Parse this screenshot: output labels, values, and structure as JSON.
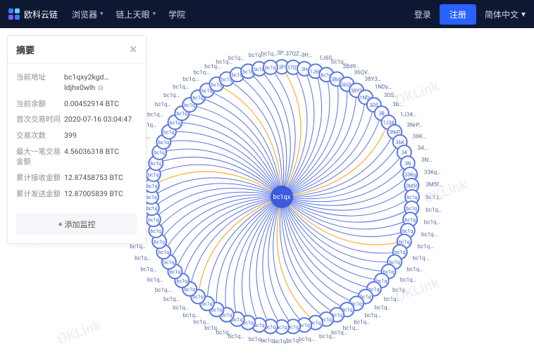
{
  "header": {
    "brand": "欧科云链",
    "nav": {
      "browser": "浏览器",
      "chain_tools": "链上天眼",
      "academy": "学院"
    },
    "login": "登录",
    "register": "注册",
    "lang": "简体中文"
  },
  "panel": {
    "title": "摘要",
    "rows": {
      "address_k": "当前地址",
      "address_v": "bc1qxy2kgd…ldjhx0wlh",
      "balance_k": "当前余额",
      "balance_v": "0.00452914 BTC",
      "first_tx_k": "首次交易时间",
      "first_tx_v": "2020-07-16 03:04:47",
      "tx_count_k": "交易次数",
      "tx_count_v": "399",
      "max_single_k": "最大一笔交易金额",
      "max_single_v": "4.56036318 BTC",
      "total_recv_k": "累计接收金额",
      "total_recv_v": "12.87458753 BTC",
      "total_sent_k": "累计发送金额",
      "total_sent_v": "12.87005839 BTC"
    },
    "add_monitor": "+ 添加监控"
  },
  "graph": {
    "center_label": "bc1qx",
    "watermark": "OKLink",
    "node_default_label": "bc1q",
    "node_labels": [
      "3P",
      "37QZ",
      "3H",
      "1J6S",
      "bc1q",
      "3Bd9",
      "36QV",
      "38Y3",
      "1NDy",
      "3DS",
      "3B",
      "1J34",
      "3NrP",
      "36K",
      "34",
      "3N",
      "33Kq",
      "3M5f",
      "bc1q",
      "bc1q",
      "bc1q",
      "bc1q",
      "bc1q",
      "bc1q",
      "bc1q",
      "bc1q",
      "bc1q",
      "bc1q",
      "bc1q",
      "bc1q",
      "bc1q",
      "bc1q",
      "bc1q",
      "bc1q",
      "bc1q",
      "bc1q",
      "bc1q",
      "bc1q",
      "bc1q",
      "bc1q",
      "bc1q",
      "bc1q",
      "bc1q",
      "bc1q",
      "bc1q",
      "bc1q",
      "bc1q",
      "bc1q",
      "bc1q",
      "bc1q",
      "bc1q",
      "bc1q",
      "bc1q",
      "bc1q",
      "bc1q",
      "bc1q",
      "bc1q",
      "bc1q",
      "bc1q",
      "bc1q",
      "bc1q",
      "bc1q",
      "bc1q",
      "bc1q",
      "bc1q",
      "bc1q",
      "bc1q",
      "bc1q",
      "bc1q",
      "bc1q",
      "bc1q",
      "bc1q"
    ]
  },
  "chart_data": {
    "type": "network",
    "center": "bc1qx",
    "node_count": 72,
    "edge_colors": {
      "primary": "#3b5bdb",
      "arrow": "#f5a623"
    },
    "node_color": "#5878e0",
    "layout": "radial-spiral"
  }
}
